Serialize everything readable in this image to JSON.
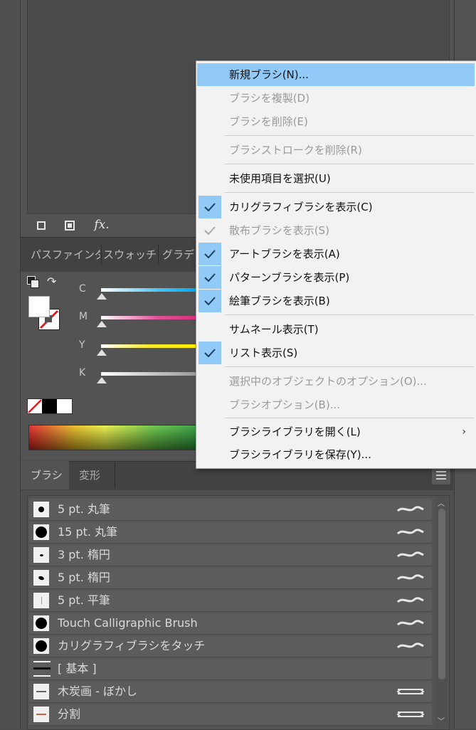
{
  "appearance_panel": {
    "fx_label": "fx."
  },
  "panel_tabs": [
    {
      "label": "パスファインダ"
    },
    {
      "label": "スウォッチ"
    },
    {
      "label": "グラデ"
    }
  ],
  "color_panel": {
    "channels": [
      {
        "label": "C",
        "color": "#4fc3f7"
      },
      {
        "label": "M",
        "color": "#e0509a"
      },
      {
        "label": "Y",
        "color": "#f5e92a"
      },
      {
        "label": "K",
        "color": "#bdbdbd"
      }
    ]
  },
  "brush_panel": {
    "tabs": [
      {
        "label": "ブラシ",
        "active": true
      },
      {
        "label": "変形",
        "active": false
      }
    ],
    "brushes": [
      {
        "name": "5 pt. 丸筆",
        "icon": "dot-small",
        "type": "calligraphic-icon"
      },
      {
        "name": "15 pt. 丸筆",
        "icon": "dot-large",
        "type": "calligraphic-icon"
      },
      {
        "name": "3 pt. 楕円",
        "icon": "ellipse-small",
        "type": "calligraphic-icon"
      },
      {
        "name": "5 pt. 楕円",
        "icon": "ellipse-medium",
        "type": "calligraphic-icon"
      },
      {
        "name": "5 pt. 平筆",
        "icon": "flat",
        "type": "calligraphic-icon"
      },
      {
        "name": "Touch Calligraphic Brush",
        "icon": "dot-large",
        "type": "calligraphic-icon"
      },
      {
        "name": "カリグラフィブラシをタッチ",
        "icon": "dot-large",
        "type": "calligraphic-icon"
      },
      {
        "name": "[ 基本 ]",
        "icon": "basic-line",
        "type": ""
      },
      {
        "name": "木炭画 - ぼかし",
        "icon": "charcoal",
        "type": "art-icon"
      },
      {
        "name": "分割",
        "icon": "divide",
        "type": "art-icon"
      }
    ]
  },
  "context_menu": {
    "items": [
      {
        "label": "新規ブラシ(N)...",
        "enabled": true,
        "checked": false,
        "highlighted": true
      },
      {
        "label": "ブラシを複製(D)",
        "enabled": false,
        "checked": false
      },
      {
        "label": "ブラシを削除(E)",
        "enabled": false,
        "checked": false
      },
      {
        "separator": true
      },
      {
        "label": "ブラシストロークを削除(R)",
        "enabled": false,
        "checked": false
      },
      {
        "separator": true
      },
      {
        "label": "未使用項目を選択(U)",
        "enabled": true,
        "checked": false
      },
      {
        "separator": true
      },
      {
        "label": "カリグラフィブラシを表示(C)",
        "enabled": true,
        "checked": true
      },
      {
        "label": "散布ブラシを表示(S)",
        "enabled": false,
        "checked": true
      },
      {
        "label": "アートブラシを表示(A)",
        "enabled": true,
        "checked": true
      },
      {
        "label": "パターンブラシを表示(P)",
        "enabled": true,
        "checked": true
      },
      {
        "label": "絵筆ブラシを表示(B)",
        "enabled": true,
        "checked": true
      },
      {
        "separator": true
      },
      {
        "label": "サムネール表示(T)",
        "enabled": true,
        "checked": false
      },
      {
        "label": "リスト表示(S)",
        "enabled": true,
        "checked": true
      },
      {
        "separator": true
      },
      {
        "label": "選択中のオブジェクトのオプション(O)...",
        "enabled": false,
        "checked": false
      },
      {
        "label": "ブラシオプション(B)...",
        "enabled": false,
        "checked": false
      },
      {
        "separator": true
      },
      {
        "label": "ブラシライブラリを開く(L)",
        "enabled": true,
        "checked": false,
        "submenu": true
      },
      {
        "label": "ブラシライブラリを保存(Y)...",
        "enabled": true,
        "checked": false
      }
    ],
    "submenu_arrow": "›"
  },
  "colors": {
    "highlight": "#91c9f7",
    "panel_bg": "#535353"
  }
}
